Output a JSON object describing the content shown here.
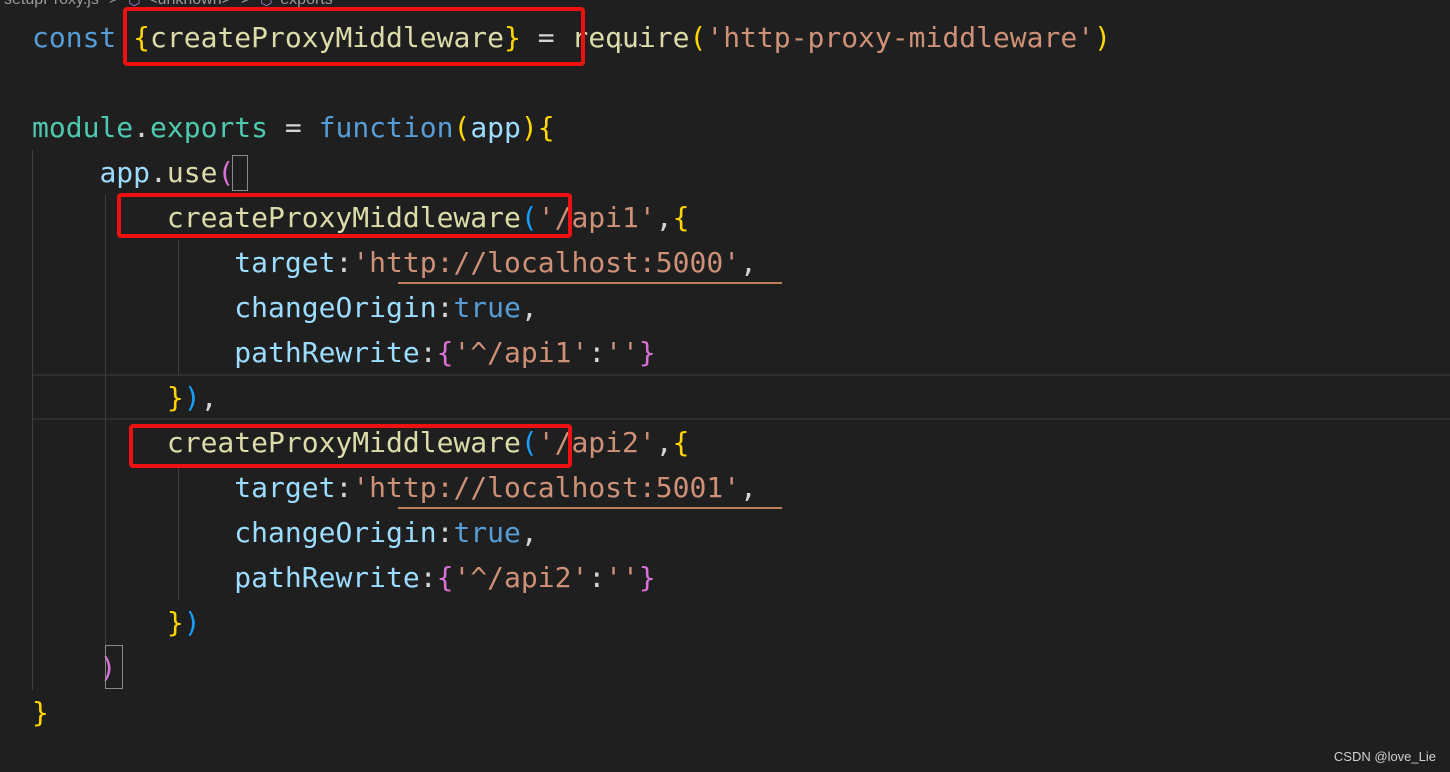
{
  "colors": {
    "background": "#1f1f1f",
    "keyword": "#569cd6",
    "variable": "#9cdcfe",
    "function": "#dcdcaa",
    "string": "#ce9178",
    "punctuation": "#d4d4d4",
    "bracket_gold": "#ffd700",
    "bracket_pink": "#da70d6",
    "bracket_blue": "#179fff",
    "module": "#4ec9b0",
    "annotation_red": "#ee1111"
  },
  "breadcrumb": {
    "file": "setupProxy.js",
    "symbol_1": "<unknown>",
    "symbol_2": "exports",
    "separator": ">",
    "symbol_icon": "symbol-method-icon"
  },
  "code_lines": [
    {
      "tokens": [
        {
          "text": "const ",
          "color": "#569cd6"
        },
        {
          "text": "{",
          "color": "#ffd700"
        },
        {
          "text": "createProxyMiddleware",
          "color": "#dcdcaa"
        },
        {
          "text": "}",
          "color": "#ffd700"
        },
        {
          "text": " = ",
          "color": "#d4d4d4"
        },
        {
          "text": "require",
          "color": "#dcdcaa"
        },
        {
          "text": "(",
          "color": "#ffd700"
        },
        {
          "text": "'http-proxy-middleware'",
          "color": "#ce9178"
        },
        {
          "text": ")",
          "color": "#ffd700"
        }
      ]
    },
    {
      "tokens": []
    },
    {
      "tokens": [
        {
          "text": "module",
          "color": "#4ec9b0"
        },
        {
          "text": ".",
          "color": "#d4d4d4"
        },
        {
          "text": "exports",
          "color": "#4ec9b0"
        },
        {
          "text": " = ",
          "color": "#d4d4d4"
        },
        {
          "text": "function",
          "color": "#569cd6"
        },
        {
          "text": "(",
          "color": "#ffd700"
        },
        {
          "text": "app",
          "color": "#9cdcfe"
        },
        {
          "text": ")",
          "color": "#ffd700"
        },
        {
          "text": "{",
          "color": "#ffd700"
        }
      ]
    },
    {
      "tokens": [
        {
          "text": "    ",
          "color": "#d4d4d4"
        },
        {
          "text": "app",
          "color": "#9cdcfe"
        },
        {
          "text": ".",
          "color": "#d4d4d4"
        },
        {
          "text": "use",
          "color": "#dcdcaa"
        },
        {
          "text": "(",
          "color": "#da70d6"
        }
      ]
    },
    {
      "tokens": [
        {
          "text": "        ",
          "color": "#d4d4d4"
        },
        {
          "text": "createProxyMiddleware",
          "color": "#dcdcaa"
        },
        {
          "text": "(",
          "color": "#179fff"
        },
        {
          "text": "'/api1'",
          "color": "#ce9178"
        },
        {
          "text": ",",
          "color": "#d4d4d4"
        },
        {
          "text": "{",
          "color": "#ffd700"
        }
      ]
    },
    {
      "tokens": [
        {
          "text": "            ",
          "color": "#d4d4d4"
        },
        {
          "text": "target",
          "color": "#9cdcfe"
        },
        {
          "text": ":",
          "color": "#d4d4d4"
        },
        {
          "text": "'",
          "color": "#ce9178"
        },
        {
          "text": "http://localhost:5000",
          "color": "#ce9178"
        },
        {
          "text": "'",
          "color": "#ce9178"
        },
        {
          "text": ",",
          "color": "#d4d4d4"
        }
      ]
    },
    {
      "tokens": [
        {
          "text": "            ",
          "color": "#d4d4d4"
        },
        {
          "text": "changeOrigin",
          "color": "#9cdcfe"
        },
        {
          "text": ":",
          "color": "#d4d4d4"
        },
        {
          "text": "true",
          "color": "#569cd6"
        },
        {
          "text": ",",
          "color": "#d4d4d4"
        }
      ]
    },
    {
      "tokens": [
        {
          "text": "            ",
          "color": "#d4d4d4"
        },
        {
          "text": "pathRewrite",
          "color": "#9cdcfe"
        },
        {
          "text": ":",
          "color": "#d4d4d4"
        },
        {
          "text": "{",
          "color": "#da70d6"
        },
        {
          "text": "'^/api1'",
          "color": "#ce9178"
        },
        {
          "text": ":",
          "color": "#d4d4d4"
        },
        {
          "text": "''",
          "color": "#ce9178"
        },
        {
          "text": "}",
          "color": "#da70d6"
        }
      ]
    },
    {
      "tokens": [
        {
          "text": "        ",
          "color": "#d4d4d4"
        },
        {
          "text": "}",
          "color": "#ffd700"
        },
        {
          "text": ")",
          "color": "#179fff"
        },
        {
          "text": ",",
          "color": "#d4d4d4"
        }
      ]
    },
    {
      "tokens": [
        {
          "text": "        ",
          "color": "#d4d4d4"
        },
        {
          "text": "createProxyMiddleware",
          "color": "#dcdcaa"
        },
        {
          "text": "(",
          "color": "#179fff"
        },
        {
          "text": "'/api2'",
          "color": "#ce9178"
        },
        {
          "text": ",",
          "color": "#d4d4d4"
        },
        {
          "text": "{",
          "color": "#ffd700"
        }
      ]
    },
    {
      "tokens": [
        {
          "text": "            ",
          "color": "#d4d4d4"
        },
        {
          "text": "target",
          "color": "#9cdcfe"
        },
        {
          "text": ":",
          "color": "#d4d4d4"
        },
        {
          "text": "'",
          "color": "#ce9178"
        },
        {
          "text": "http://localhost:5001",
          "color": "#ce9178"
        },
        {
          "text": "'",
          "color": "#ce9178"
        },
        {
          "text": ",",
          "color": "#d4d4d4"
        }
      ]
    },
    {
      "tokens": [
        {
          "text": "            ",
          "color": "#d4d4d4"
        },
        {
          "text": "changeOrigin",
          "color": "#9cdcfe"
        },
        {
          "text": ":",
          "color": "#d4d4d4"
        },
        {
          "text": "true",
          "color": "#569cd6"
        },
        {
          "text": ",",
          "color": "#d4d4d4"
        }
      ]
    },
    {
      "tokens": [
        {
          "text": "            ",
          "color": "#d4d4d4"
        },
        {
          "text": "pathRewrite",
          "color": "#9cdcfe"
        },
        {
          "text": ":",
          "color": "#d4d4d4"
        },
        {
          "text": "{",
          "color": "#da70d6"
        },
        {
          "text": "'^/api2'",
          "color": "#ce9178"
        },
        {
          "text": ":",
          "color": "#d4d4d4"
        },
        {
          "text": "''",
          "color": "#ce9178"
        },
        {
          "text": "}",
          "color": "#da70d6"
        }
      ]
    },
    {
      "tokens": [
        {
          "text": "        ",
          "color": "#d4d4d4"
        },
        {
          "text": "}",
          "color": "#ffd700"
        },
        {
          "text": ")",
          "color": "#179fff"
        }
      ]
    },
    {
      "tokens": [
        {
          "text": "    ",
          "color": "#d4d4d4"
        },
        {
          "text": ")",
          "color": "#da70d6"
        }
      ]
    },
    {
      "tokens": [
        {
          "text": "}",
          "color": "#ffd700"
        }
      ]
    }
  ],
  "watermark": "CSDN @love_Lie"
}
